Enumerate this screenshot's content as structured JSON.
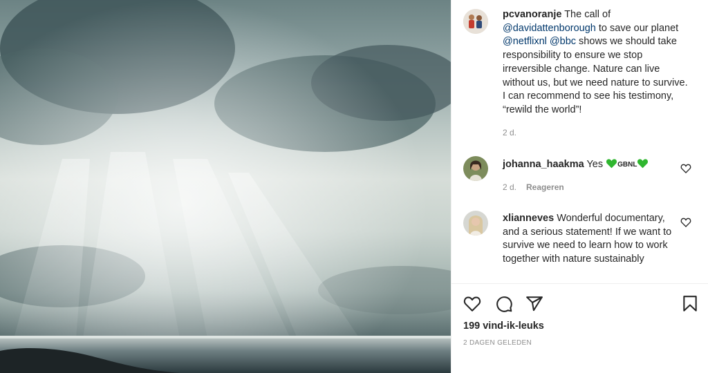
{
  "post": {
    "image_alt": "Sunbeams breaking through clouds over the sea",
    "author": {
      "username": "pcvanoranje",
      "caption_parts": [
        {
          "type": "text",
          "value": "The call of "
        },
        {
          "type": "mention",
          "value": "@davidattenborough"
        },
        {
          "type": "text",
          "value": " to save our planet "
        },
        {
          "type": "mention",
          "value": "@netflixnl"
        },
        {
          "type": "text",
          "value": " "
        },
        {
          "type": "mention",
          "value": "@bbc"
        },
        {
          "type": "text",
          "value": " shows we should take responsibility to ensure we stop irreversible change. Nature can live without us, but we need nature to survive. I can recommend to see his testimony, “rewild the world”!"
        }
      ],
      "time": "2 d."
    },
    "comments": [
      {
        "username": "johanna_haakma",
        "text_before": "Yes ",
        "emoji_text": "GBNL",
        "time": "2 d.",
        "reply_label": "Reageren"
      },
      {
        "username": "xlianneves",
        "text": "Wonderful documentary, and a serious statement! If we want to survive we need to learn how to work together with nature sustainably"
      }
    ],
    "likes": "199 vind-ik-leuks",
    "date": "2 DAGEN GELEDEN",
    "icons": [
      "heart-icon",
      "comment-icon",
      "share-icon",
      "bookmark-icon"
    ]
  },
  "colors": {
    "mention": "#00376b",
    "text": "#262626",
    "muted": "#8e8e8e",
    "emoji_green": "#2fb62f"
  }
}
